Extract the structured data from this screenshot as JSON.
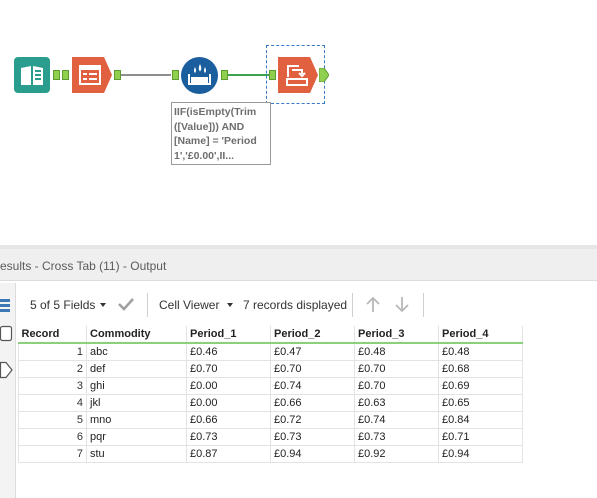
{
  "workflow": {
    "annotation": "IIF(isEmpty(Trim\n([Value])) AND\n[Name] = 'Period\n1','£0.00',II..."
  },
  "results": {
    "title": "esults - Cross Tab (11) - Output",
    "fields_label": "5 of 5 Fields",
    "viewer_label": "Cell Viewer",
    "records_label": "7 records displayed"
  },
  "table": {
    "columns": [
      "Record",
      "Commodity",
      "Period_1",
      "Period_2",
      "Period_3",
      "Period_4"
    ],
    "rows": [
      [
        "1",
        "abc",
        "£0.46",
        "£0.47",
        "£0.48",
        "£0.48"
      ],
      [
        "2",
        "def",
        "£0.70",
        "£0.70",
        "£0.70",
        "£0.68"
      ],
      [
        "3",
        "ghi",
        "£0.00",
        "£0.74",
        "£0.70",
        "£0.69"
      ],
      [
        "4",
        "jkl",
        "£0.00",
        "£0.66",
        "£0.63",
        "£0.65"
      ],
      [
        "5",
        "mno",
        "£0.66",
        "£0.72",
        "£0.74",
        "£0.84"
      ],
      [
        "6",
        "pqr",
        "£0.73",
        "£0.73",
        "£0.73",
        "£0.71"
      ],
      [
        "7",
        "stu",
        "£0.87",
        "£0.94",
        "£0.92",
        "£0.94"
      ]
    ]
  },
  "icons": {
    "input": "book-input-icon",
    "select": "select-tool-icon",
    "formula": "formula-tool-icon",
    "crosstab": "cross-tab-icon",
    "fields_check": "check-icon",
    "sort_up": "arrow-up-icon",
    "sort_down": "arrow-down-icon"
  },
  "colors": {
    "input_tool": "#2a9d8f",
    "prep_tool": "#e0603f",
    "formula_tool": "#1b5e9e",
    "anchor": "#8fd14f",
    "header_underline": "#8bd07d"
  }
}
